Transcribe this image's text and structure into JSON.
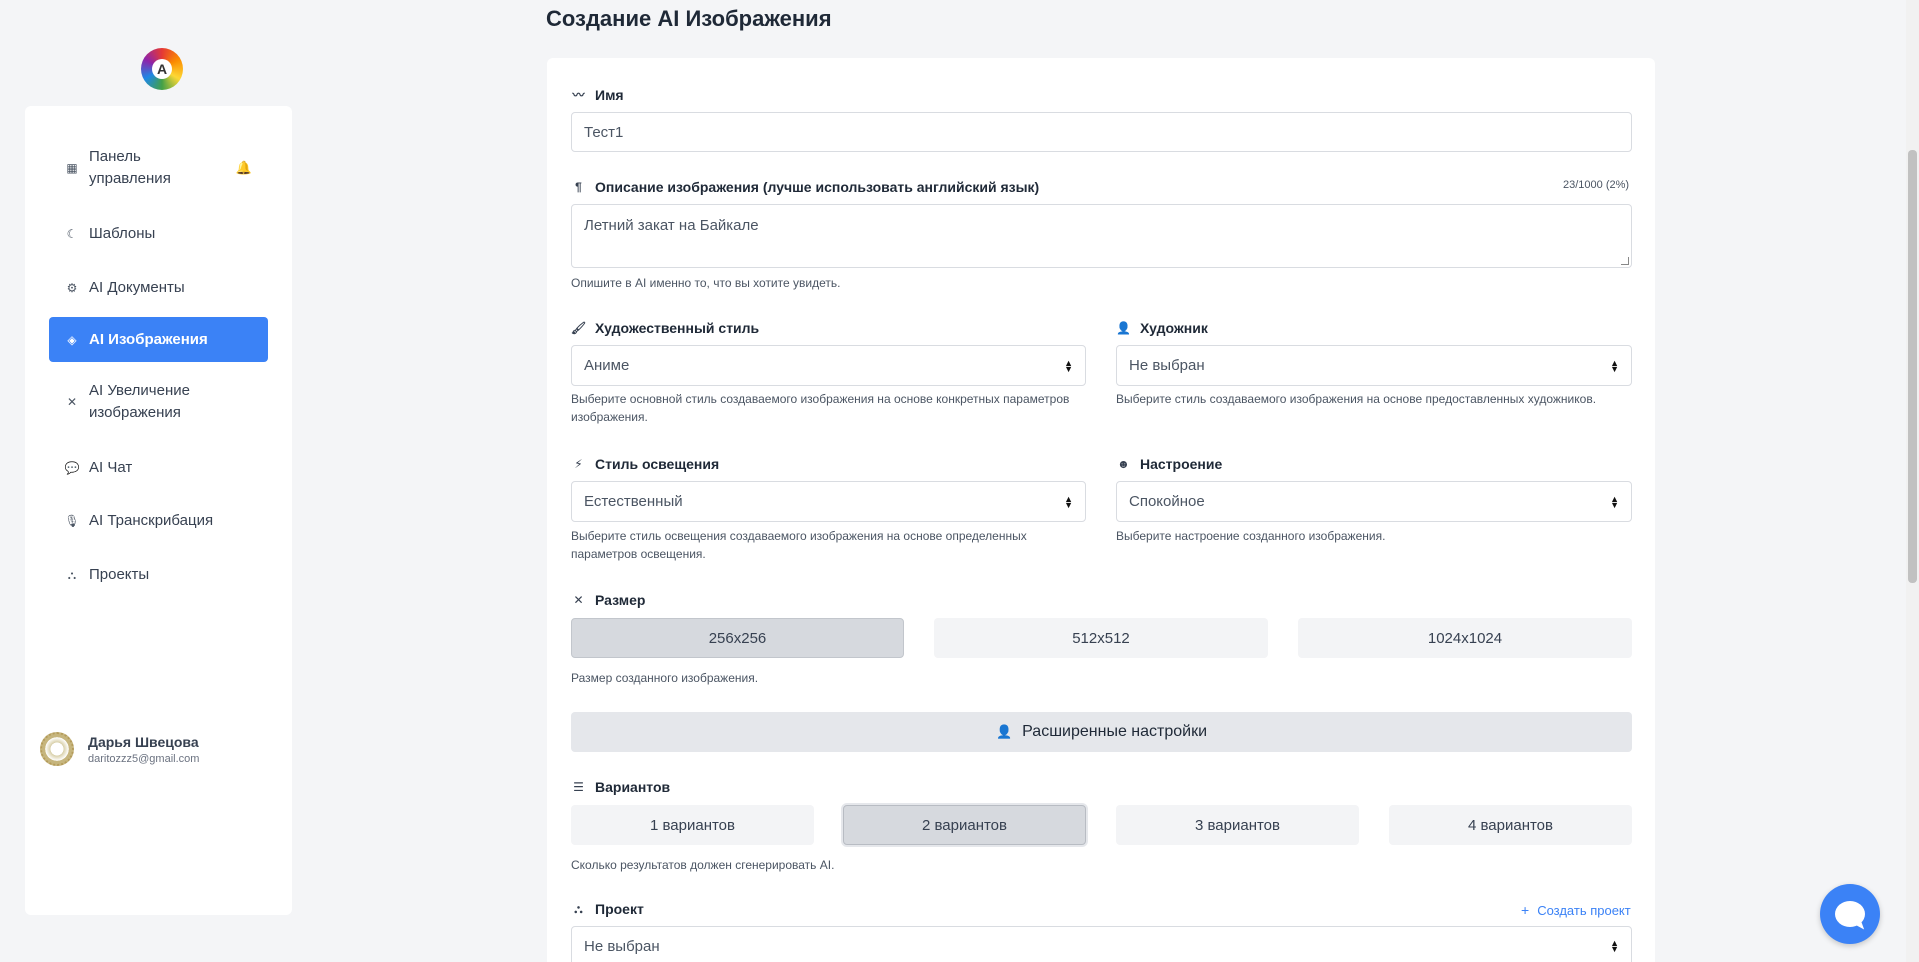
{
  "logo": {
    "letter": "A"
  },
  "sidebar": {
    "items": [
      {
        "label": "Панель управления",
        "icon": "grid-icon"
      },
      {
        "label": "Шаблоны",
        "icon": "moon-icon"
      },
      {
        "label": "AI Документы",
        "icon": "robot-icon"
      },
      {
        "label": "AI Изображения",
        "icon": "shapes-icon",
        "active": true
      },
      {
        "label": "AI Увеличение изображения",
        "icon": "expand-icon"
      },
      {
        "label": "AI Чат",
        "icon": "comments-icon"
      },
      {
        "label": "AI Транскрибация",
        "icon": "microphone-icon"
      },
      {
        "label": "Проекты",
        "icon": "project-diagram-icon"
      }
    ],
    "user": {
      "name": "Дарья Швецова",
      "email": "daritozzz5@gmail.com"
    }
  },
  "page": {
    "title": "Создание AI Изображения"
  },
  "form": {
    "name": {
      "label": "Имя",
      "value": "Тест1"
    },
    "description": {
      "label": "Описание изображения (лучше использовать английский язык)",
      "counter": "23/1000 (2%)",
      "value": "Летний закат на Байкале",
      "hint": "Опишите в AI именно то, что вы хотите увидеть."
    },
    "art_style": {
      "label": "Художественный стиль",
      "value": "Аниме",
      "hint": "Выберите основной стиль создаваемого изображения на основе конкретных параметров изображения."
    },
    "artist": {
      "label": "Художник",
      "value": "Не выбран",
      "hint": "Выберите стиль создаваемого изображения на основе предоставленных художников."
    },
    "lighting": {
      "label": "Стиль освещения",
      "value": "Естественный",
      "hint": "Выберите стиль освещения создаваемого изображения на основе определенных параметров освещения."
    },
    "mood": {
      "label": "Настроение",
      "value": "Спокойное",
      "hint": "Выберите настроение созданного изображения."
    },
    "size": {
      "label": "Размер",
      "options": [
        "256x256",
        "512x512",
        "1024x1024"
      ],
      "selected": "256x256",
      "hint": "Размер созданного изображения."
    },
    "advanced": {
      "label": "Расширенные настройки"
    },
    "variants": {
      "label": "Вариантов",
      "options": [
        "1 вариантов",
        "2 вариантов",
        "3 вариантов",
        "4 вариантов"
      ],
      "selected": "2 вариантов",
      "hint": "Сколько результатов должен сгенерировать AI."
    },
    "project": {
      "label": "Проект",
      "create_label": "Создать проект",
      "value": "Не выбран"
    }
  }
}
